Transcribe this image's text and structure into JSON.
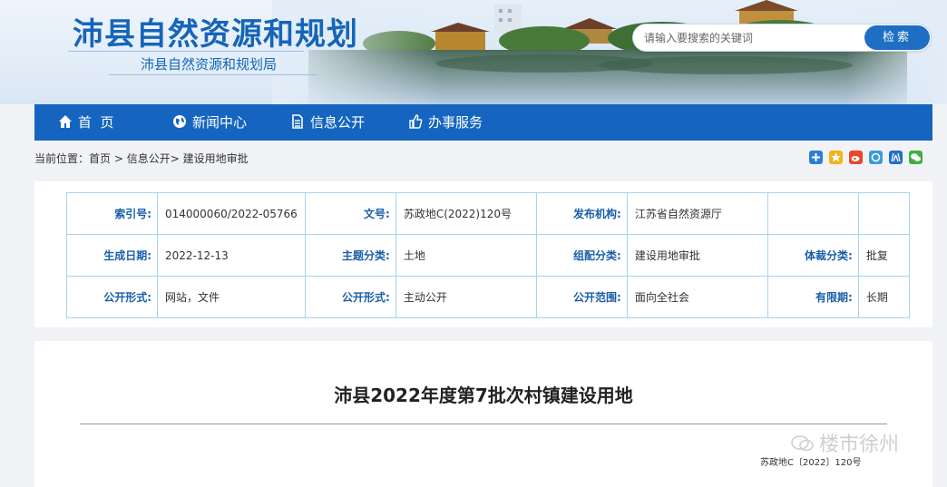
{
  "header": {
    "site_title": "沛县自然资源和规划",
    "site_subtitle": "沛县自然资源和规划局",
    "search": {
      "placeholder": "请输入要搜索的关键词",
      "button_label": "检索"
    }
  },
  "nav": {
    "items": [
      {
        "label": "首  页",
        "icon": "home-icon"
      },
      {
        "label": "新闻中心",
        "icon": "globe-icon"
      },
      {
        "label": "信息公开",
        "icon": "document-icon"
      },
      {
        "label": "办事服务",
        "icon": "thumbs-up-icon"
      }
    ]
  },
  "breadcrumb": {
    "prefix": "当前位置：",
    "items": [
      "首页",
      "信息公开",
      "建设用地审批"
    ],
    "sep": ">"
  },
  "share_icons": [
    "plus-share-icon",
    "star-share-icon",
    "weibo-share-icon",
    "qzone-share-icon",
    "renren-share-icon",
    "wechat-share-icon"
  ],
  "meta": {
    "rows": [
      [
        {
          "k": "索引号:",
          "v": "014000060/2022-05766"
        },
        {
          "k": "文号:",
          "v": "苏政地C(2022)120号"
        },
        {
          "k": "发布机构:",
          "v": "江苏省自然资源厅"
        },
        {
          "k": "",
          "v": ""
        }
      ],
      [
        {
          "k": "生成日期:",
          "v": "2022-12-13"
        },
        {
          "k": "主题分类:",
          "v": "土地"
        },
        {
          "k": "组配分类:",
          "v": "建设用地审批"
        },
        {
          "k": "体裁分类:",
          "v": "批复"
        }
      ],
      [
        {
          "k": "公开形式:",
          "v": "网站，文件"
        },
        {
          "k": "公开形式:",
          "v": "主动公开"
        },
        {
          "k": "公开范围:",
          "v": "面向全社会"
        },
        {
          "k": "有限期:",
          "v": "长期"
        }
      ]
    ]
  },
  "document": {
    "title": "沛县2022年度第7批次村镇建设用地",
    "doc_number": "苏政地C〔2022〕120号",
    "watermark": "楼市徐州"
  },
  "colors": {
    "brand": "#1565c0",
    "title": "#1565b8",
    "label": "#1a5ea8"
  }
}
